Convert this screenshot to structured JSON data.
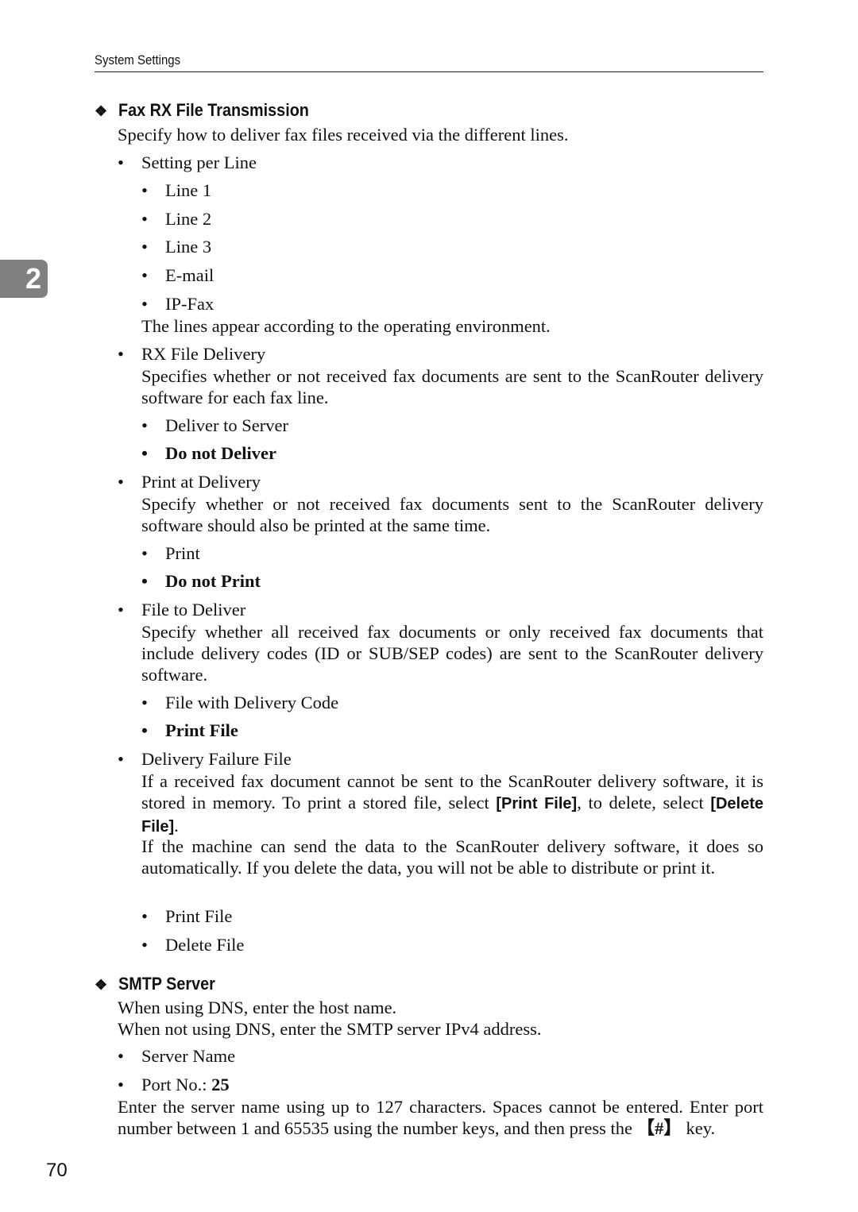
{
  "header": "System Settings",
  "chapter_tab": "2",
  "page_number": "70",
  "sections": {
    "fax": {
      "title": "Fax RX File Transmission",
      "intro": "Specify how to deliver fax files received via the different lines.",
      "setting_per_line": "Setting per Line",
      "lines": [
        "Line 1",
        "Line 2",
        "Line 3",
        "E-mail",
        "IP-Fax"
      ],
      "lines_note": "The lines appear according to the operating environment.",
      "rx_file_delivery": "RX File Delivery",
      "rx_desc": "Specifies whether or not received fax documents are sent to the ScanRouter delivery software for each fax line.",
      "rx_opts": [
        "Deliver to Server",
        "Do not Deliver"
      ],
      "print_at_delivery": "Print at Delivery",
      "print_desc": "Specify whether or not received fax documents sent to the ScanRouter delivery software should also be printed at the same time.",
      "print_opts": [
        "Print",
        "Do not Print"
      ],
      "file_to_deliver": "File to Deliver",
      "file_desc": "Specify whether all received fax documents or only received fax documents that include delivery codes (ID or SUB/SEP codes) are sent to the ScanRouter delivery software.",
      "file_opts": [
        "File with Delivery Code",
        "Print File"
      ],
      "failure_file": "Delivery Failure File",
      "failure_desc_a": "If a received fax document cannot be sent to the ScanRouter delivery software, it is stored in memory. To print a stored file, select ",
      "failure_key1": "[Print File]",
      "failure_desc_b": ", to delete, select ",
      "failure_key2": "[Delete File]",
      "failure_desc_c": ".",
      "failure_desc2": "If the machine can send the data to the ScanRouter delivery software, it does so automatically. If you delete the data, you will not be able to distribute or print it.",
      "failure_opts": [
        "Print File",
        "Delete File"
      ]
    },
    "smtp": {
      "title": "SMTP Server",
      "dns": "When using DNS, enter the host name.",
      "nodns": "When not using DNS, enter the SMTP server IPv4 address.",
      "server_name": "Server Name",
      "port_label": "Port No.: ",
      "port_default": "25",
      "note_a": "Enter the server name using up to 127 characters. Spaces cannot be entered. Enter port number between 1 and 65535 using the number keys, and then press the ",
      "note_key": "【#】",
      "note_b": " key."
    }
  }
}
